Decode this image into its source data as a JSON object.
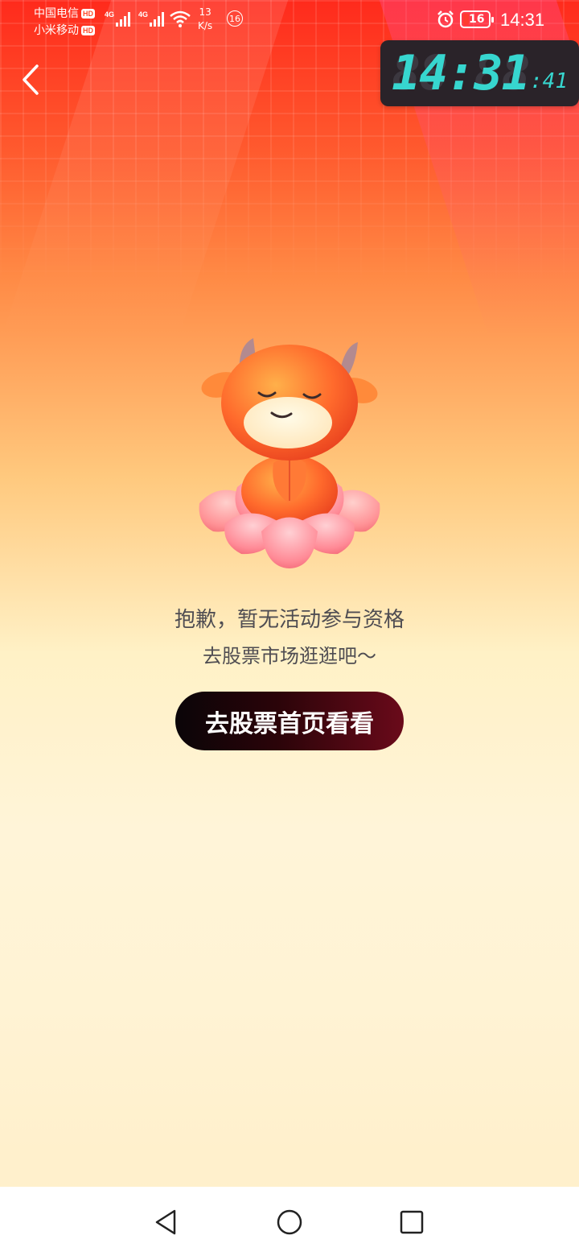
{
  "status_bar": {
    "carrier_1": "中国电信",
    "carrier_2": "小米移动",
    "hd_label": "HD",
    "network_type": "4G",
    "net_speed_value": "13",
    "net_speed_unit": "K/s",
    "notification_badge": "16",
    "battery_level": "16",
    "time": "14:31"
  },
  "floating_clock": {
    "hours_minutes": "14:31",
    "seconds": ":41"
  },
  "navigation": {
    "back_icon": "chevron-left-icon"
  },
  "content": {
    "message_line_1": "抱歉，暂无活动参与资格",
    "message_line_2": "去股票市场逛逛吧～",
    "cta_button_label": "去股票首页看看"
  },
  "system_nav": {
    "back": "triangle-back-icon",
    "home": "circle-home-icon",
    "recents": "square-recents-icon"
  },
  "colors": {
    "header_red": "#ff2a1c",
    "button_dark": "#0a0508",
    "button_wine": "#6a0a1a",
    "clock_digits": "#37d6cf",
    "text_gray": "#4f4d52"
  }
}
